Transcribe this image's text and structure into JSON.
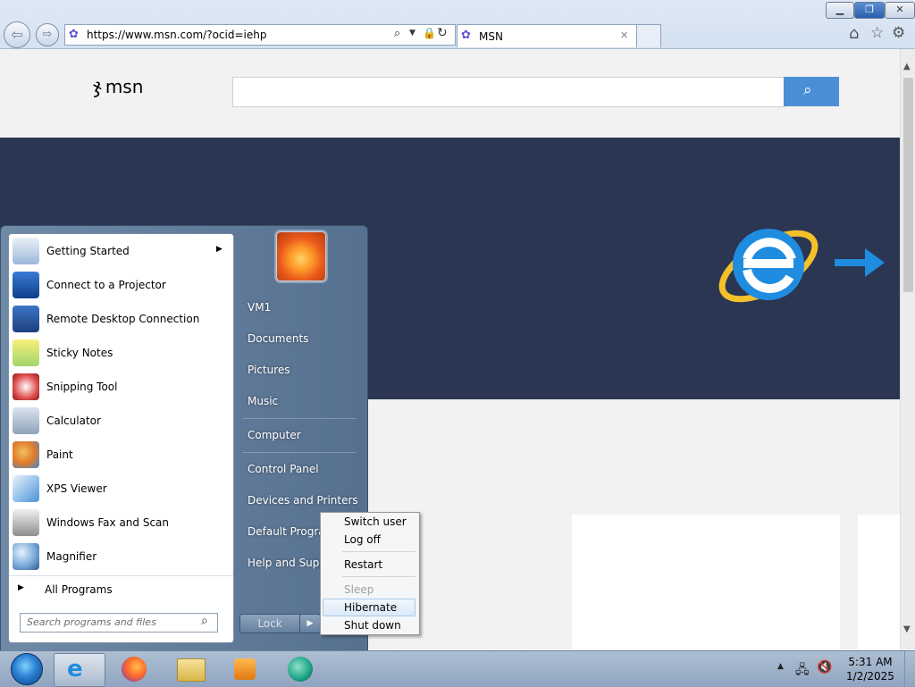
{
  "browser": {
    "url": "https://www.msn.com/?ocid=iehp",
    "tab_title": "MSN",
    "window_buttons": [
      "minimize-icon",
      "restore-icon",
      "close-icon"
    ]
  },
  "msn": {
    "logo_text": "msn",
    "search_placeholder": ""
  },
  "start_menu": {
    "programs": [
      {
        "label": "Getting Started",
        "icon": "getting-started-icon",
        "has_submenu": true
      },
      {
        "label": "Connect to a Projector",
        "icon": "projector-icon"
      },
      {
        "label": "Remote Desktop Connection",
        "icon": "remote-desktop-icon"
      },
      {
        "label": "Sticky Notes",
        "icon": "sticky-notes-icon"
      },
      {
        "label": "Snipping Tool",
        "icon": "snipping-tool-icon"
      },
      {
        "label": "Calculator",
        "icon": "calculator-icon"
      },
      {
        "label": "Paint",
        "icon": "paint-icon"
      },
      {
        "label": "XPS Viewer",
        "icon": "xps-viewer-icon"
      },
      {
        "label": "Windows Fax and Scan",
        "icon": "fax-scan-icon"
      },
      {
        "label": "Magnifier",
        "icon": "magnifier-icon"
      }
    ],
    "all_programs": "All Programs",
    "search_placeholder": "Search programs and files",
    "right_items": [
      "VM1",
      "Documents",
      "Pictures",
      "Music",
      "Computer",
      "Control Panel",
      "Devices and Printers",
      "Default Programs",
      "Help and Support"
    ],
    "lock_label": "Lock"
  },
  "power_menu": {
    "items": [
      "Switch user",
      "Log off",
      "Restart",
      "Sleep",
      "Hibernate",
      "Shut down"
    ]
  },
  "taskbar": {
    "time": "5:31 AM",
    "date": "1/2/2025"
  }
}
